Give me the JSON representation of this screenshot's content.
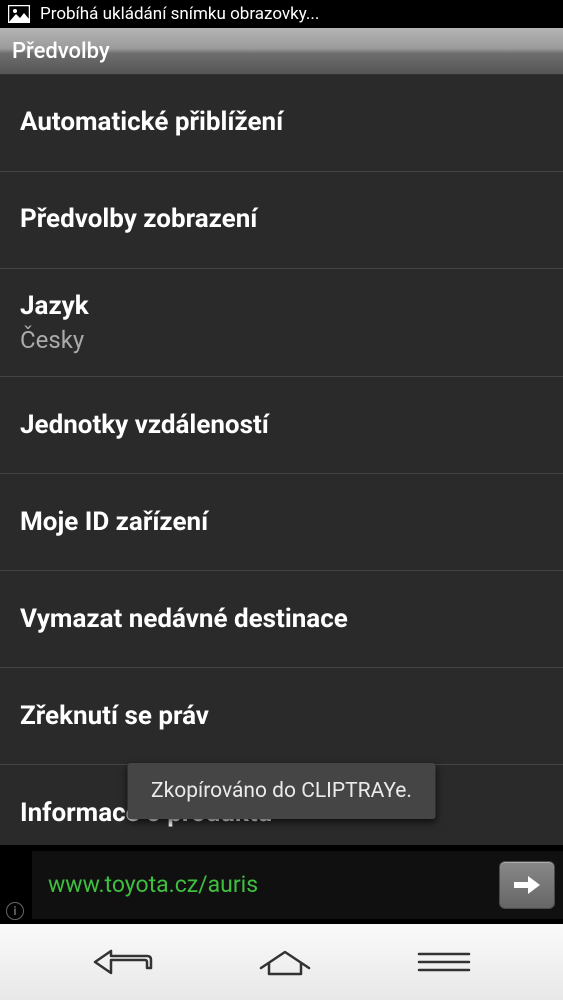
{
  "statusBar": {
    "text": "Probíhá ukládání snímku obrazovky..."
  },
  "header": {
    "title": "Předvolby"
  },
  "items": [
    {
      "title": "Automatické přiblížení",
      "subtitle": ""
    },
    {
      "title": "Předvolby zobrazení",
      "subtitle": ""
    },
    {
      "title": "Jazyk",
      "subtitle": "Česky"
    },
    {
      "title": "Jednotky vzdáleností",
      "subtitle": ""
    },
    {
      "title": "Moje ID zařízení",
      "subtitle": ""
    },
    {
      "title": "Vymazat nedávné destinace",
      "subtitle": ""
    },
    {
      "title": "Zřeknutí se práv",
      "subtitle": ""
    },
    {
      "title": "Informace o produktu",
      "subtitle": ""
    }
  ],
  "toast": {
    "message": "Zkopírováno do CLIPTRAYe."
  },
  "ad": {
    "link": "www.toyota.cz/auris"
  }
}
